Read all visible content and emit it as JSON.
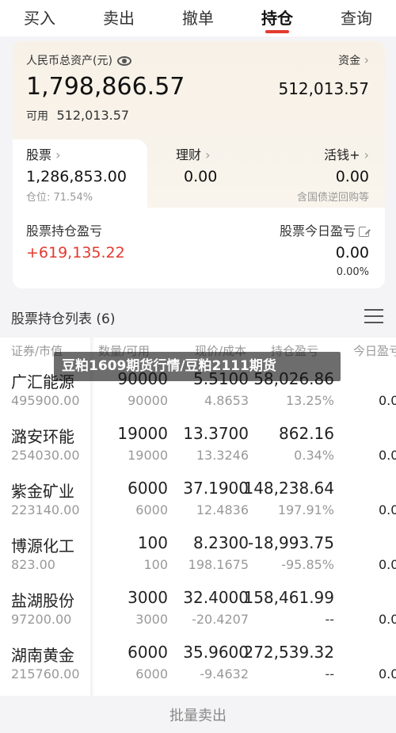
{
  "tabs": [
    {
      "label": "买入"
    },
    {
      "label": "卖出"
    },
    {
      "label": "撤单"
    },
    {
      "label": "持仓"
    },
    {
      "label": "查询"
    }
  ],
  "assets": {
    "total_label": "人民币总资产(元)",
    "total_value": "1,798,866.57",
    "available_label": "可用",
    "available_value": "512,013.57",
    "funds_label": "资金",
    "funds_value": "512,013.57"
  },
  "segments": {
    "stock_label": "股票",
    "stock_value": "1,286,853.00",
    "stock_pos": "仓位: 71.54%",
    "wealth_label": "理财",
    "wealth_value": "0.00",
    "cash_label": "活钱+",
    "cash_value": "0.00",
    "cash_note": "含国债逆回购等"
  },
  "pnl": {
    "holding_label": "股票持仓盈亏",
    "holding_value": "+619,135.22",
    "today_label": "股票今日盈亏",
    "today_value": "0.00",
    "today_pct": "0.00%"
  },
  "list": {
    "title": "股票持仓列表 (6)",
    "columns": [
      "证券/市值",
      "数量/可用",
      "现价/成本",
      "持仓盈亏",
      "今日盈亏"
    ]
  },
  "rows": [
    {
      "name": "广汇能源",
      "market": "495900.00",
      "qty": "90000",
      "avail": "90000",
      "price": "5.5100",
      "cost": "4.8653",
      "pnl": "58,026.86",
      "pnl_pct": "13.25%",
      "today": "0.0"
    },
    {
      "name": "潞安环能",
      "market": "254030.00",
      "qty": "19000",
      "avail": "19000",
      "price": "13.3700",
      "cost": "13.3246",
      "pnl": "862.16",
      "pnl_pct": "0.34%",
      "today": "0.0"
    },
    {
      "name": "紫金矿业",
      "market": "223140.00",
      "qty": "6000",
      "avail": "6000",
      "price": "37.1900",
      "cost": "12.4836",
      "pnl": "148,238.64",
      "pnl_pct": "197.91%",
      "today": "0.0"
    },
    {
      "name": "博源化工",
      "market": "823.00",
      "qty": "100",
      "avail": "100",
      "price": "8.2300",
      "cost": "198.1675",
      "pnl": "-18,993.75",
      "pnl_pct": "-95.85%",
      "today": "0.0"
    },
    {
      "name": "盐湖股份",
      "market": "97200.00",
      "qty": "3000",
      "avail": "3000",
      "price": "32.4000",
      "cost": "-20.4207",
      "pnl": "158,461.99",
      "pnl_pct": "--",
      "today": "0.0"
    },
    {
      "name": "湖南黄金",
      "market": "215760.00",
      "qty": "6000",
      "avail": "6000",
      "price": "35.9600",
      "cost": "-9.4632",
      "pnl": "272,539.32",
      "pnl_pct": "--",
      "today": "0.0"
    }
  ],
  "footer": {
    "batch_sell": "批量卖出"
  },
  "overlay": {
    "text": "豆粕1609期货行情/豆粕2111期货"
  },
  "colors": {
    "accent": "#e33a2f",
    "gain": "#e33a2f",
    "loss": "#1f9e5d"
  }
}
